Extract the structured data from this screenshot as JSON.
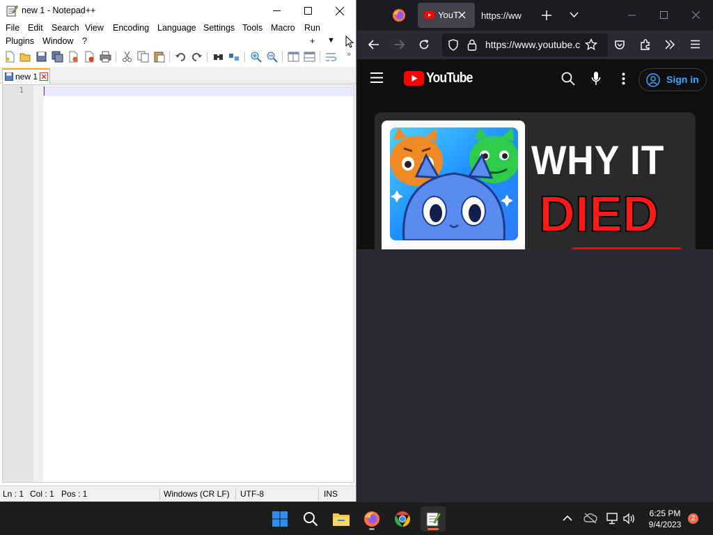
{
  "notepad": {
    "title": "new 1 - Notepad++",
    "menu_row1": [
      "File",
      "Edit",
      "Search",
      "View",
      "Encoding",
      "Language",
      "Settings",
      "Tools",
      "Macro",
      "Run"
    ],
    "menu_row2": [
      "Plugins",
      "Window",
      "?"
    ],
    "menu_plus": "+",
    "menu_dropdown": "▼",
    "tab_label": "new 1",
    "line_number": "1",
    "status": {
      "ln": "Ln : 1",
      "col": "Col : 1",
      "pos": "Pos : 1",
      "eol": "Windows (CR LF)",
      "encoding": "UTF-8",
      "mode": "INS"
    }
  },
  "firefox": {
    "tab_title": "YouT",
    "tab2_title": "https://ww",
    "url": "https://www.youtube.c",
    "youtube": {
      "brand": "YouTube",
      "signin_label": "Sign in",
      "thumb_line1": "WHY IT",
      "thumb_line2": "DIED"
    }
  },
  "taskbar": {
    "time": "6:25 PM",
    "date": "9/4/2023",
    "notification_count": "2"
  },
  "colors": {
    "youtube_red": "#ff0000",
    "signin_blue": "#3ea6ff",
    "npp_tab_accent": "#f5a623",
    "caret_purple": "#8000ff"
  }
}
